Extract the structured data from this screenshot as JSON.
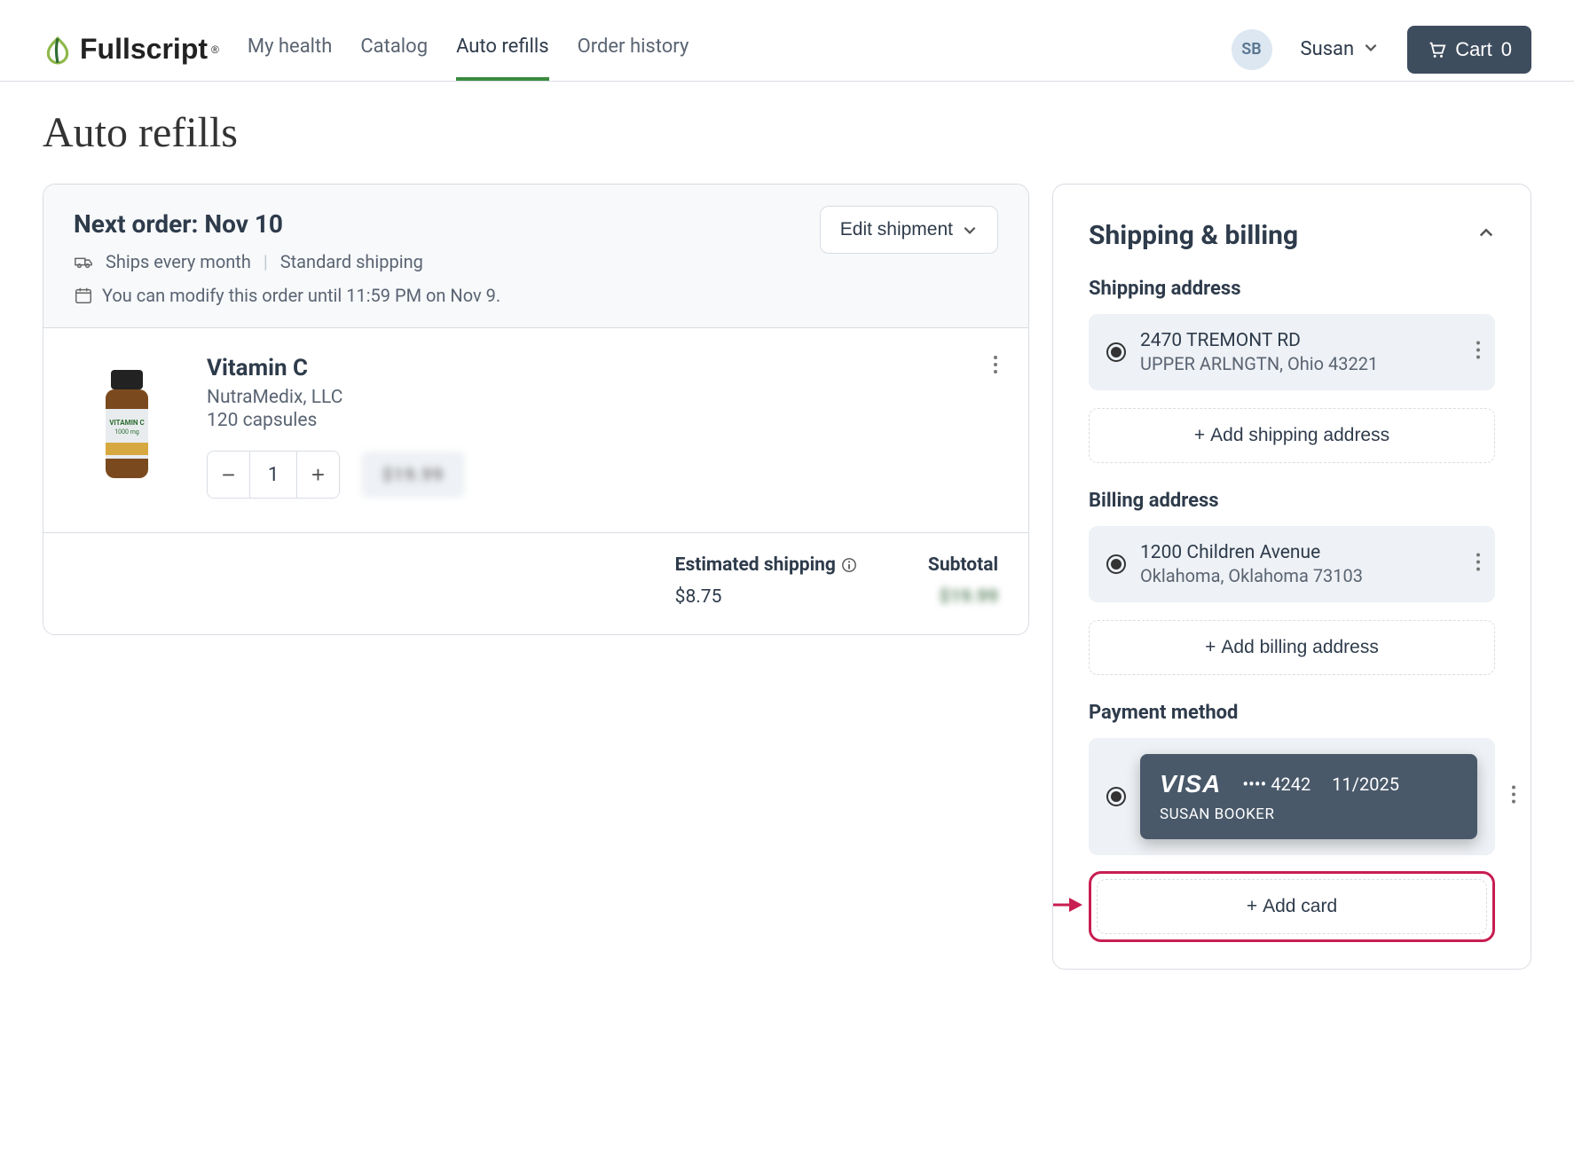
{
  "brand": "Fullscript",
  "nav": {
    "items": [
      "My health",
      "Catalog",
      "Auto refills",
      "Order history"
    ],
    "active_index": 2
  },
  "user": {
    "initials": "SB",
    "name": "Susan"
  },
  "cart": {
    "label": "Cart",
    "count": 0
  },
  "page_title": "Auto refills",
  "order": {
    "title": "Next order: Nov 10",
    "ships_every": "Ships every month",
    "shipping_type": "Standard shipping",
    "modify_note": "You can modify this order until 11:59 PM on Nov 9.",
    "edit_label": "Edit shipment"
  },
  "item": {
    "name": "Vitamin C",
    "brand": "NutraMedix, LLC",
    "size": "120 capsules",
    "qty": 1,
    "price_obscured": "$19.99"
  },
  "totals": {
    "est_shipping_label": "Estimated shipping",
    "est_shipping_value": "$8.75",
    "subtotal_label": "Subtotal",
    "subtotal_obscured": "$19.99"
  },
  "sidebar": {
    "header": "Shipping & billing",
    "shipping_label": "Shipping address",
    "shipping_addr": {
      "line1": "2470 TREMONT RD",
      "line2": "UPPER ARLNGTN, Ohio 43221"
    },
    "add_shipping": "Add shipping address",
    "billing_label": "Billing address",
    "billing_addr": {
      "line1": "1200 Children Avenue",
      "line2": "Oklahoma, Oklahoma 73103"
    },
    "add_billing": "Add billing address",
    "payment_label": "Payment method",
    "card": {
      "brand": "VISA",
      "last4": "•••• 4242",
      "exp": "11/2025",
      "name": "SUSAN BOOKER"
    },
    "add_card": "Add card"
  }
}
